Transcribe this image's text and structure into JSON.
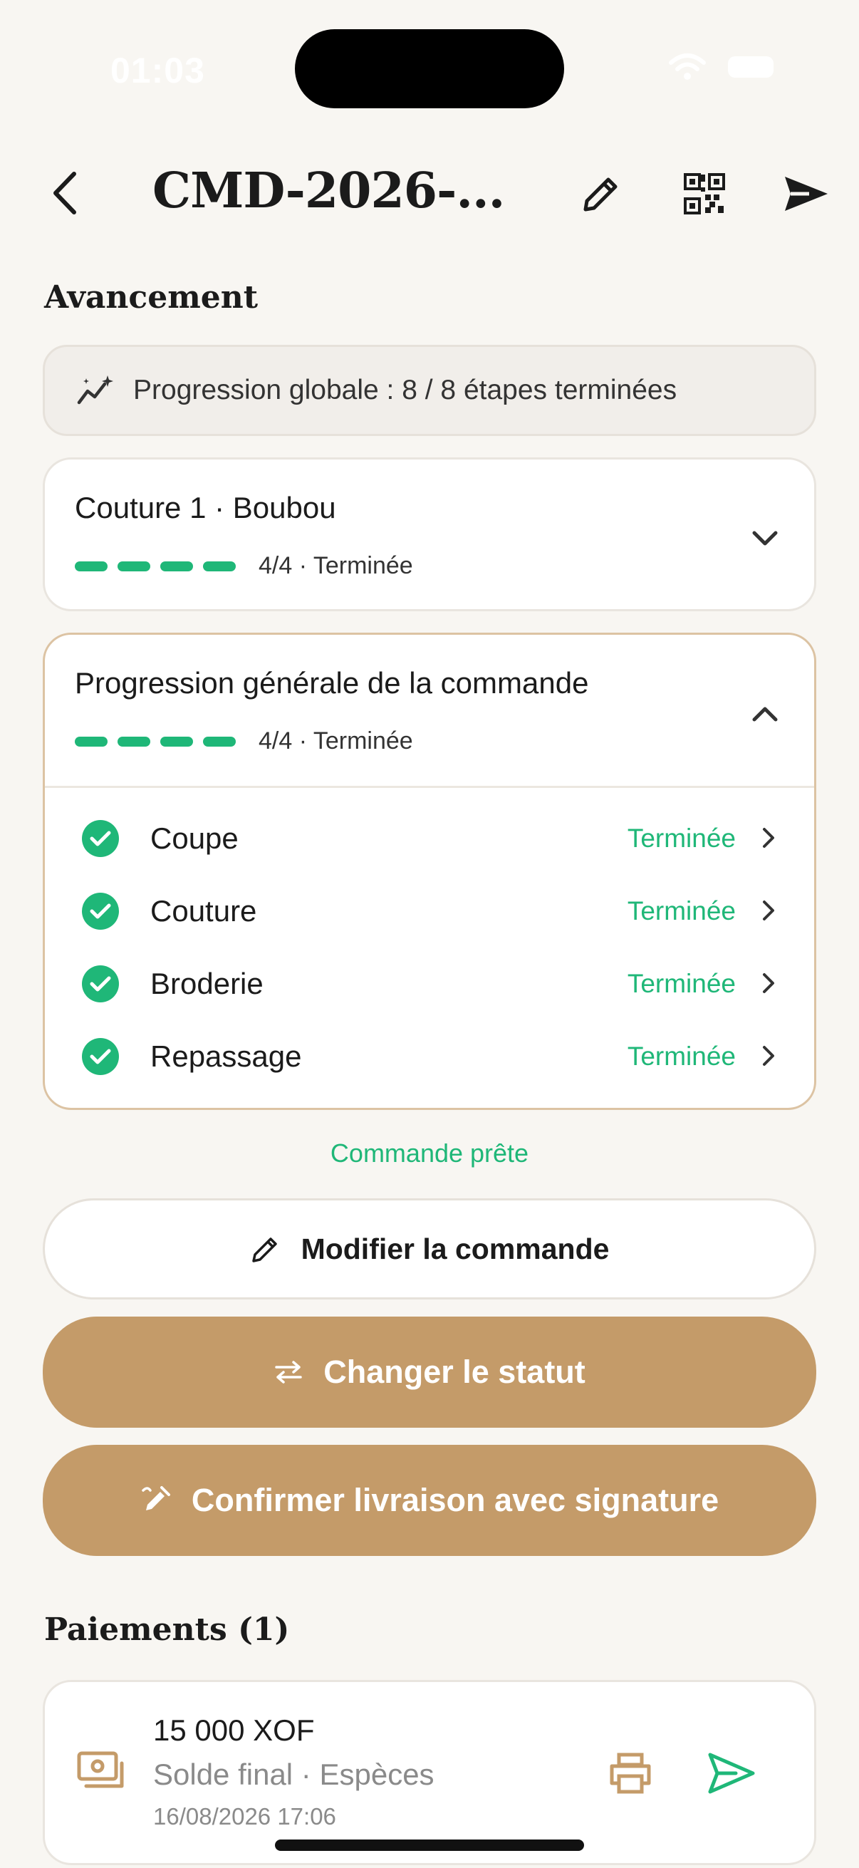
{
  "status_bar": {
    "time": "01:03"
  },
  "header": {
    "title": "CMD-2026-..."
  },
  "sections": {
    "progress": "Avancement",
    "payments": "Paiements (1)"
  },
  "progress_banner": {
    "text": "Progression globale : 8 / 8 étapes terminées",
    "completed": 8,
    "total": 8
  },
  "cards": [
    {
      "title": "Couture 1 · Boubou",
      "progress_label": "4/4 · Terminée",
      "completed": 4,
      "total": 4,
      "expanded": false
    },
    {
      "title": "Progression générale de la commande",
      "progress_label": "4/4 · Terminée",
      "completed": 4,
      "total": 4,
      "expanded": true,
      "steps": [
        {
          "name": "Coupe",
          "status": "Terminée"
        },
        {
          "name": "Couture",
          "status": "Terminée"
        },
        {
          "name": "Broderie",
          "status": "Terminée"
        },
        {
          "name": "Repassage",
          "status": "Terminée"
        }
      ]
    }
  ],
  "ready_text": "Commande prête",
  "buttons": {
    "edit_order": "Modifier la commande",
    "change_status": "Changer le statut",
    "confirm_delivery": "Confirmer livraison avec signature"
  },
  "payment": {
    "amount": "15 000 XOF",
    "details": "Solde final · Espèces",
    "date": "16/08/2026 17:06"
  },
  "colors": {
    "accent_gold": "#c49b69",
    "success_green": "#1fb778",
    "background": "#f8f6f2"
  }
}
